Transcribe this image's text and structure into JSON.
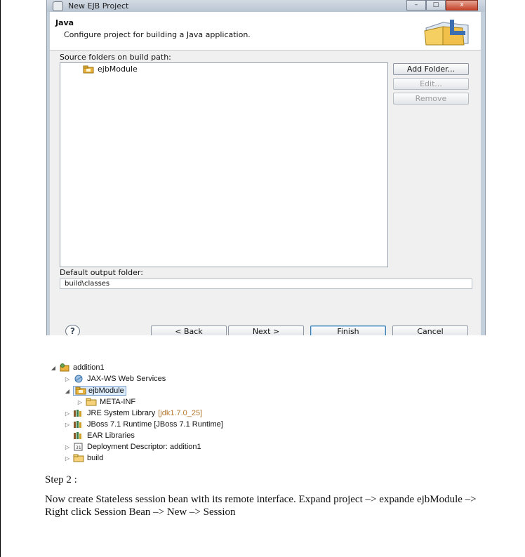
{
  "dialog": {
    "title": "New EJB Project",
    "window_buttons": [
      "–",
      "□",
      "x"
    ],
    "header_title": "Java",
    "header_description": "Configure project for building a Java application.",
    "source_folders_label": "Source folders on build path:",
    "source_folders": [
      {
        "name": "ejbModule",
        "icon": "source-folder-icon"
      }
    ],
    "buttons": {
      "add_folder": "Add Folder...",
      "edit": "Edit...",
      "remove": "Remove",
      "back": "< Back",
      "next": "Next >",
      "finish": "Finish",
      "cancel": "Cancel"
    },
    "default_output_label": "Default output folder:",
    "default_output_value": "build\\classes",
    "help_glyph": "?"
  },
  "project_tree": {
    "root": "addition1",
    "items": {
      "jaxws": "JAX-WS Web Services",
      "ejbmodule": "ejbModule",
      "metainf": "META-INF",
      "jre": "JRE System Library",
      "jre_suffix": "[jdk1.7.0_25]",
      "jboss": "JBoss 7.1 Runtime [JBoss 7.1 Runtime]",
      "ear": "EAR Libraries",
      "deploy": "Deployment Descriptor: addition1",
      "build": "build"
    }
  },
  "doc": {
    "step_label": "Step 2 :",
    "paragraph": "Now create Stateless session bean with its remote interface. Expand project –> expande ejbModule –> Right click Session Bean –> New –> Session"
  },
  "colors": {
    "dialog_frame": "#c4cfdc",
    "selection": "#dcebfc",
    "folder": "#e9b23a"
  }
}
